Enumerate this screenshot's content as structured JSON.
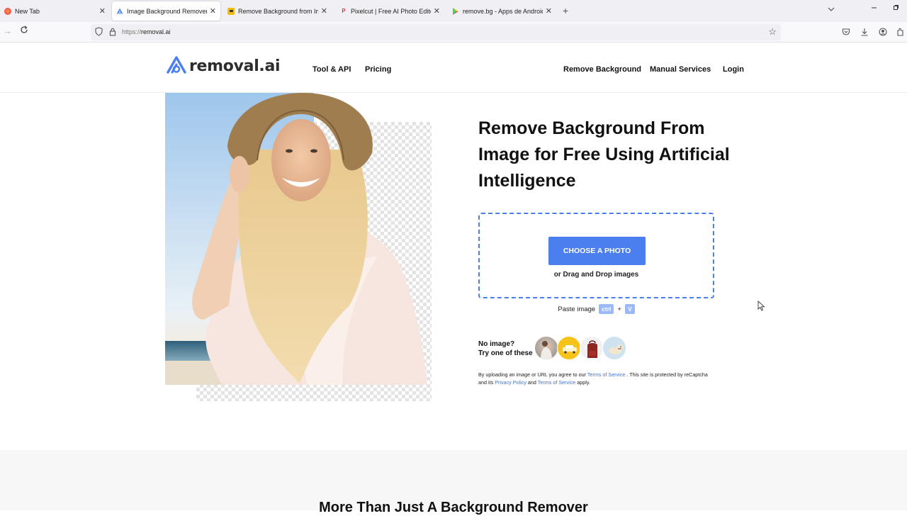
{
  "browser": {
    "tabs": [
      {
        "title": "New Tab",
        "favicon": "firefox-icon",
        "active": false
      },
      {
        "title": "Image Background Remover | R",
        "favicon": "removal-ai-icon",
        "active": true
      },
      {
        "title": "Remove Background from Ima",
        "favicon": "yellow-site-icon",
        "active": false
      },
      {
        "title": "Pixelcut | Free AI Photo Editor",
        "favicon": "pixelcut-icon",
        "active": false
      },
      {
        "title": "remove.bg - Apps de Android e",
        "favicon": "google-play-icon",
        "active": false
      }
    ],
    "new_tab_label": "+",
    "close_glyph": "✕",
    "url_prefix": "https://",
    "url_domain": "removal.ai"
  },
  "header": {
    "logo_text": "removal.ai",
    "nav_left": [
      "Tool & API",
      "Pricing"
    ],
    "nav_right": [
      "Remove Background",
      "Manual Services",
      "Login"
    ]
  },
  "hero": {
    "title": "Remove Background From Image for Free Using Artificial Intelligence",
    "choose_button": "CHOOSE A PHOTO",
    "drag_text": "or Drag and Drop images",
    "paste_label": "Paste image",
    "paste_key1": "ctrl",
    "paste_plus": "+",
    "paste_key2": "V",
    "sample_line1": "No image?",
    "sample_line2": "Try one of these",
    "samples": [
      "family-photo",
      "yellow-car",
      "red-backpack",
      "dog"
    ],
    "terms": {
      "t1": "By uploading an image or URL you agree to our ",
      "link1": "Terms of Service",
      "t2": " . This site is protected by reCaptcha and its ",
      "link2": "Privacy Policy",
      "t3": " and ",
      "link3": "Terms of Service",
      "t4": " apply."
    }
  },
  "section2": {
    "title": "More Than Just A Background Remover"
  },
  "colors": {
    "accent": "#4b7ff0",
    "dashed_border": "#4a7ef0",
    "link": "#3b73d9"
  }
}
